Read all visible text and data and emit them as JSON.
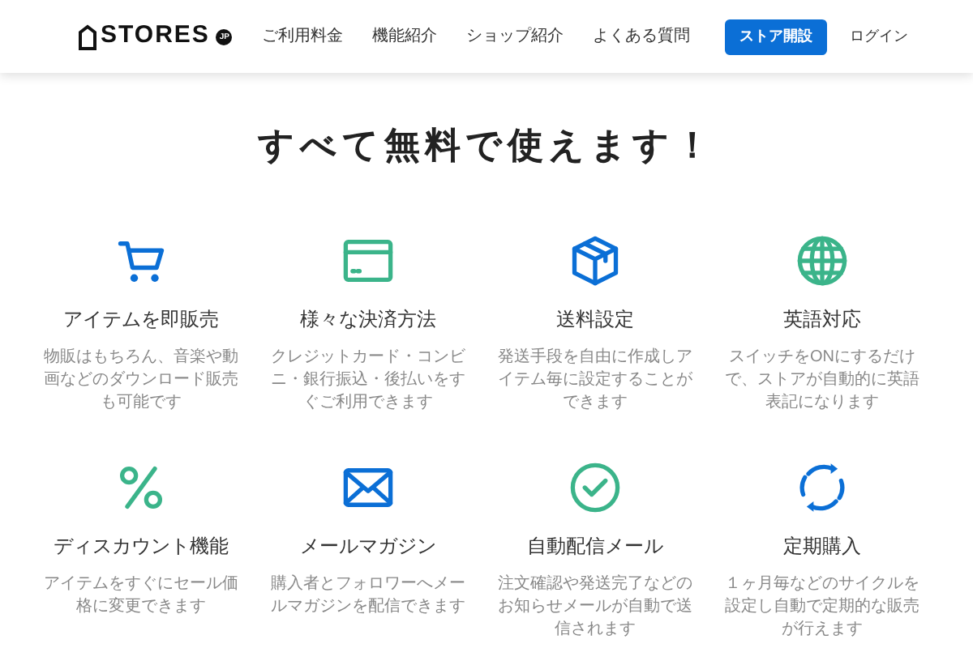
{
  "header": {
    "logo": "STORES",
    "logo_badge": "JP",
    "nav": [
      "ご利用料金",
      "機能紹介",
      "ショップ紹介",
      "よくある質問"
    ],
    "cta": "ストア開設",
    "login": "ログイン"
  },
  "heading": "すべて無料で使えます！",
  "features": [
    {
      "kind": "cart",
      "color": "#0b6fd6",
      "title": "アイテムを即販売",
      "description": "物販はもちろん、音楽や動画などのダウンロード販売も可能です"
    },
    {
      "kind": "card",
      "color": "#3bb48a",
      "title": "様々な決済方法",
      "description": "クレジットカード・コンビニ・銀行振込・後払いをすぐご利用できます"
    },
    {
      "kind": "box",
      "color": "#0b6fd6",
      "title": "送料設定",
      "description": "発送手段を自由に作成しアイテム毎に設定することができます"
    },
    {
      "kind": "globe",
      "color": "#3bb48a",
      "title": "英語対応",
      "description": "スイッチをONにするだけで、ストアが自動的に英語表記になります"
    },
    {
      "kind": "percent",
      "color": "#3bb48a",
      "title": "ディスカウント機能",
      "description": "アイテムをすぐにセール価格に変更できます"
    },
    {
      "kind": "mail",
      "color": "#0b6fd6",
      "title": "メールマガジン",
      "description": "購入者とフォロワーへメールマガジンを配信できます"
    },
    {
      "kind": "check",
      "color": "#3bb48a",
      "title": "自動配信メール",
      "description": "注文確認や発送完了などのお知らせメールが自動で送信されます"
    },
    {
      "kind": "cycle",
      "color": "#0b6fd6",
      "title": "定期購入",
      "description": "１ヶ月毎などのサイクルを設定し自動で定期的な販売が行えます"
    }
  ]
}
